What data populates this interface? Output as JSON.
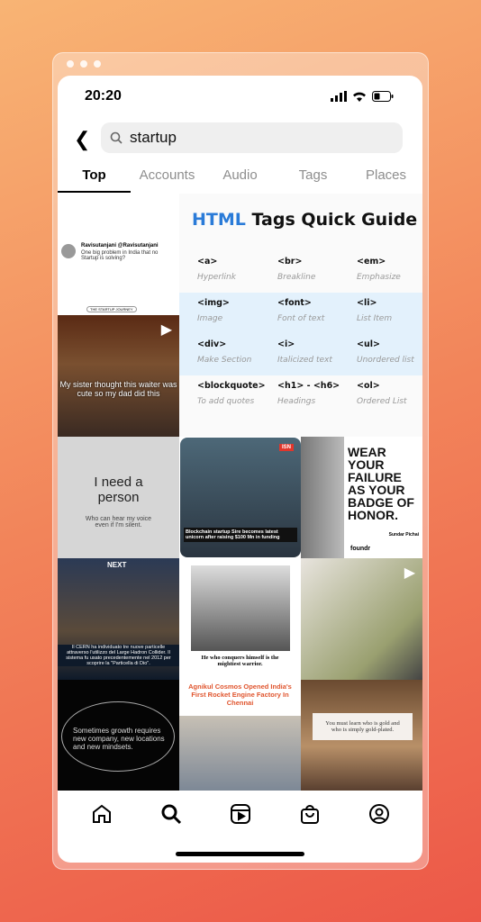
{
  "status": {
    "time": "20:20"
  },
  "search": {
    "query": "startup"
  },
  "tabs": [
    "Top",
    "Accounts",
    "Audio",
    "Tags",
    "Places"
  ],
  "grid": {
    "tweet": {
      "author": "Ravisutanjani @Ravisutanjani",
      "text": "One big problem in India that no Startup is solving?"
    },
    "video1": {
      "badge": "THE STARTUP JOURNEY",
      "caption": "My sister thought this waiter was cute so my dad did this"
    },
    "guide": {
      "title_accent": "HTML",
      "title_rest": " Tags Quick Guide",
      "items": [
        {
          "tag": "<a>",
          "desc": "Hyperlink"
        },
        {
          "tag": "<br>",
          "desc": "Breakline"
        },
        {
          "tag": "<em>",
          "desc": "Emphasize"
        },
        {
          "tag": "<img>",
          "desc": "Image"
        },
        {
          "tag": "<font>",
          "desc": "Font of text"
        },
        {
          "tag": "<li>",
          "desc": "List Item"
        },
        {
          "tag": "<div>",
          "desc": "Make Section"
        },
        {
          "tag": "<i>",
          "desc": "Italicized text"
        },
        {
          "tag": "<ul>",
          "desc": "Unordered list"
        },
        {
          "tag": "<blockquote>",
          "desc": "To add quotes"
        },
        {
          "tag": "<h1> - <h6>",
          "desc": "Headings"
        },
        {
          "tag": "<ol>",
          "desc": "Ordered List"
        }
      ]
    },
    "quote1": {
      "title": "I need a person",
      "sub": "Who can hear my voice even if I'm silent."
    },
    "news1": {
      "badge": "ISN",
      "caption": "Blockchain startup Sire becomes latest unicorn after raising $100 Mn in funding"
    },
    "pichai": {
      "quote": "WEAR YOUR FAILURE AS YOUR BADGE OF HONOR.",
      "author": "Sundar Pichai",
      "brand": "foundr"
    },
    "cern": {
      "brand": "NEXT",
      "caption": "Il CERN ha individuato tre nuove particelle attraverso l'utilizzo del Large Hadron Collider. Il sistema fu usato precedentemente nel 2012 per scoprire la \"Particella di Dio\"."
    },
    "vegeta": {
      "caption": "He who conquers himself is the mightiest warrior."
    },
    "growth": {
      "text": "Sometimes growth requires new company, new locations and new mindsets."
    },
    "agnikul": {
      "title": "Agnikul Cosmos Opened India's First Rocket Engine Factory In Chennai"
    },
    "gold": {
      "text": "You must learn who is gold and who is simply gold-plated."
    }
  },
  "nav": [
    "home-icon",
    "search-icon",
    "reels-icon",
    "shop-icon",
    "profile-icon"
  ]
}
